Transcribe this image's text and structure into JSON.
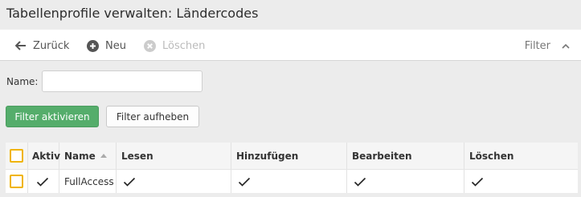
{
  "page": {
    "title": "Tabellenprofile verwalten: Ländercodes"
  },
  "toolbar": {
    "back_label": "Zurück",
    "new_label": "Neu",
    "delete_label": "Löschen",
    "filter_label": "Filter"
  },
  "filter": {
    "name_label": "Name:",
    "name_value": "",
    "name_placeholder": "",
    "apply_label": "Filter aktivieren",
    "clear_label": "Filter aufheben"
  },
  "table": {
    "headers": {
      "aktiv": "Aktiv",
      "name": "Name",
      "lesen": "Lesen",
      "hinzufuegen": "Hinzufügen",
      "bearbeiten": "Bearbeiten",
      "loeschen": "Löschen"
    },
    "rows": [
      {
        "name": "FullAccess",
        "aktiv": true,
        "lesen": true,
        "hinzufuegen": true,
        "bearbeiten": true,
        "loeschen": true
      }
    ]
  },
  "colors": {
    "accent_green": "#55ad6b",
    "checkbox_border": "#f0b400"
  }
}
